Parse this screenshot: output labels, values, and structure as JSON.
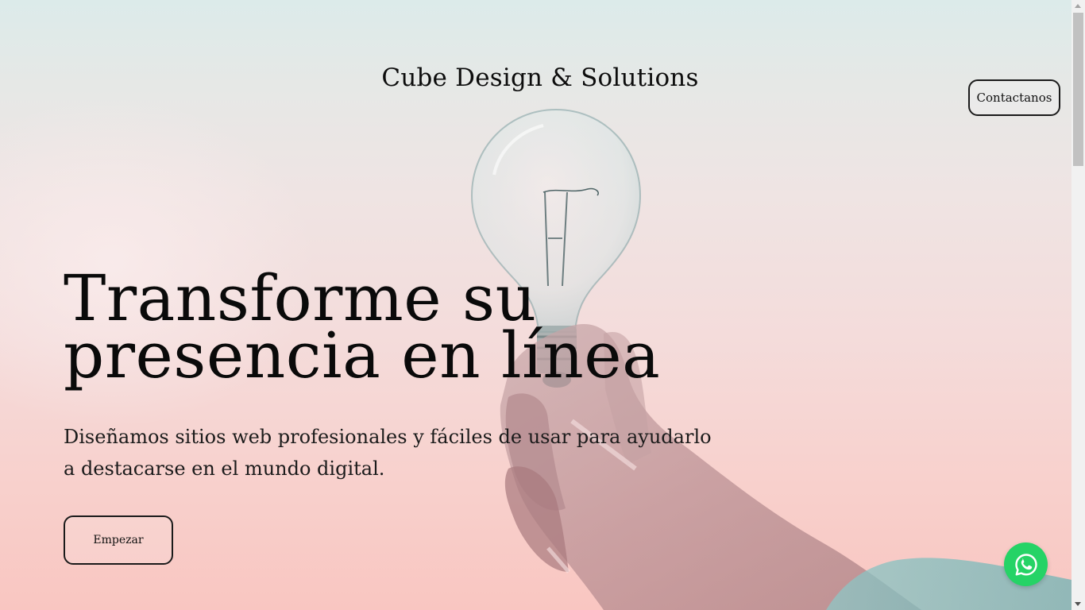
{
  "header": {
    "site_title": "Cube Design & Solutions",
    "contact_label": "Contactanos"
  },
  "hero": {
    "headline_line1": "Transforme su",
    "headline_line2": "presencia en línea",
    "subtext": "Diseñamos sitios web profesionales y fáciles de usar para ayudarlo a destacarse en el mundo digital.",
    "cta_label": "Empezar"
  },
  "floating": {
    "whatsapp_icon": "whatsapp-icon",
    "whatsapp_color": "#25d366"
  },
  "colors": {
    "text": "#111111",
    "button_border": "#1a1a1a",
    "background_top": "#dcebea",
    "background_bottom": "#f9c6c1"
  }
}
